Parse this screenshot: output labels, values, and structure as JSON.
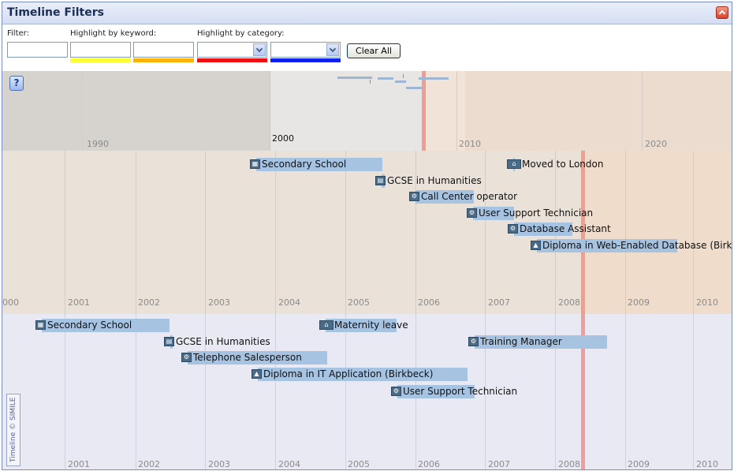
{
  "window": {
    "title": "Timeline Filters"
  },
  "filters": {
    "filter_label": "Filter:",
    "keyword_label": "Highlight by keyword:",
    "category_label": "Highlight by category:",
    "clear_label": "Clear All",
    "highlight_colors": [
      "#ffff33",
      "#ffb300",
      "#ee1111",
      "#1122ee"
    ]
  },
  "overview": {
    "ticks": [
      "1990",
      "2000",
      "2010",
      "2020"
    ]
  },
  "band1": {
    "ticks": [
      "000",
      "2001",
      "2002",
      "2003",
      "2004",
      "2005",
      "2006",
      "2007",
      "2008",
      "2009",
      "2010"
    ],
    "events": [
      {
        "label": "Secondary School",
        "icon": "school-icon"
      },
      {
        "label": "GCSE in Humanities",
        "icon": "certificate-icon"
      },
      {
        "label": "Call Center operator",
        "icon": "job-icon"
      },
      {
        "label": "User Support Technician",
        "icon": "job-icon"
      },
      {
        "label": "Database Assistant",
        "icon": "job-icon"
      },
      {
        "label": "Diploma in Web-Enabled Database (Birkbe",
        "icon": "graduation-icon"
      },
      {
        "label": "Moved to London",
        "icon": "home-icon"
      }
    ]
  },
  "band2": {
    "ticks": [
      "2001",
      "2002",
      "2003",
      "2004",
      "2005",
      "2006",
      "2007",
      "2008",
      "2009",
      "2010"
    ],
    "events": [
      {
        "label": "Secondary School",
        "icon": "school-icon"
      },
      {
        "label": "GCSE in Humanities",
        "icon": "certificate-icon"
      },
      {
        "label": "Telephone Salesperson",
        "icon": "job-icon"
      },
      {
        "label": "Diploma in IT Application (Birkbeck)",
        "icon": "graduation-icon"
      },
      {
        "label": "User Support Technician",
        "icon": "job-icon"
      },
      {
        "label": "Maternity leave",
        "icon": "home-icon"
      },
      {
        "label": "Training Manager",
        "icon": "job-icon"
      }
    ]
  },
  "help": {
    "glyph": "?"
  },
  "credit": {
    "text": "Timeline © SIMILE"
  }
}
